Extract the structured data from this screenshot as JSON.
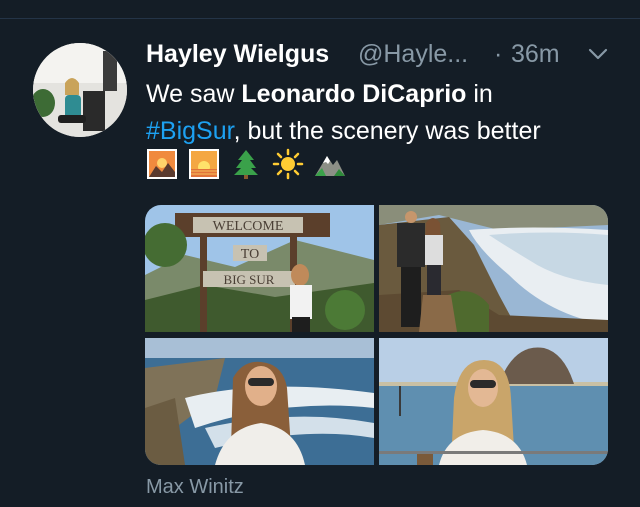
{
  "tweet": {
    "display_name": "Hayley Wielgus",
    "handle": "@Hayle...",
    "separator": "·",
    "time": "36m",
    "text_part1": "We saw ",
    "text_bold": "Leonardo DiCaprio",
    "text_part2": " in",
    "hashtag": "#BigSur",
    "text_part3": ", but the scenery was better",
    "emojis": [
      "sunset-icon",
      "sunrise-icon",
      "evergreen-tree-icon",
      "sun-icon",
      "mountain-icon"
    ],
    "photo_credit": "Max Winitz",
    "photo1_sign": {
      "line1": "WELCOME",
      "line2": "TO",
      "line3": "BIG SUR"
    }
  },
  "colors": {
    "background": "#141d26",
    "link": "#1da1f2",
    "secondary_text": "#8899a6"
  }
}
